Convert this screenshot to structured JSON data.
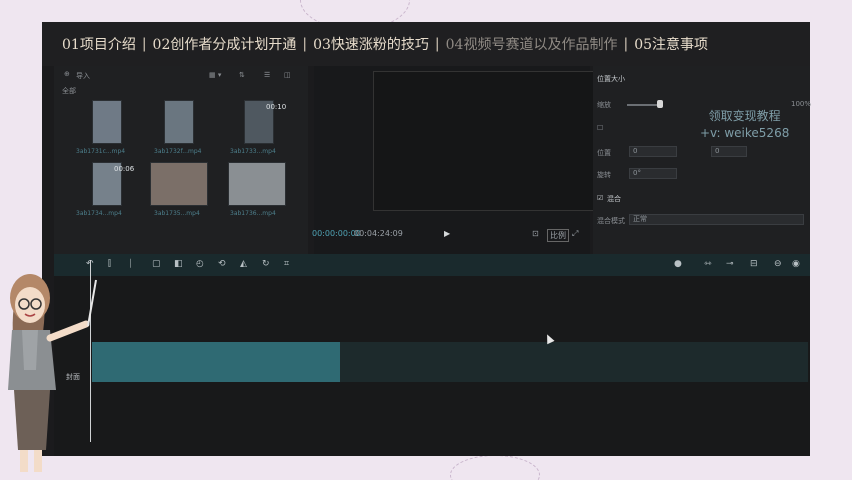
{
  "header": {
    "item1": "01项目介绍",
    "item2": "02创作者分成计划开通",
    "item3": "03快速涨粉的技巧",
    "item4": "04视频号赛道以及作品制作",
    "item5": "05注意事项"
  },
  "media": {
    "import_label": "导入",
    "section_label": "全部",
    "thumbs": [
      {
        "duration": "",
        "caption": "3ab1731c...mp4"
      },
      {
        "duration": "",
        "caption": "3ab1732f...mp4"
      },
      {
        "duration": "00:10",
        "caption": "3ab1733...mp4"
      },
      {
        "duration": "00:06",
        "caption": "3ab1734...mp4"
      },
      {
        "duration": "",
        "caption": "3ab1735...mp4"
      },
      {
        "duration": "",
        "caption": "3ab1736...mp4"
      }
    ]
  },
  "preview": {
    "current_time": "00:00:00:00",
    "total_time": "00:04:24:09",
    "ratio_label": "比例"
  },
  "properties": {
    "section_title": "位置大小",
    "scale_label": "缩放",
    "scale_value": "100%",
    "position_label": "位置",
    "rotate_label": "旋转",
    "x_value": "0",
    "y_value": "0",
    "rotate_value": "0°",
    "blend_label": "混合",
    "blend_mode_label": "混合模式",
    "blend_mode_value": "正常"
  },
  "timeline": {
    "track_label": "封面"
  },
  "watermark": {
    "line1": "领取变现教程",
    "line2": "+v: weike5268"
  },
  "colors": {
    "accent": "#2f6a73",
    "topbar_text": "#e7dccb",
    "watermark": "#8fb3bf"
  }
}
